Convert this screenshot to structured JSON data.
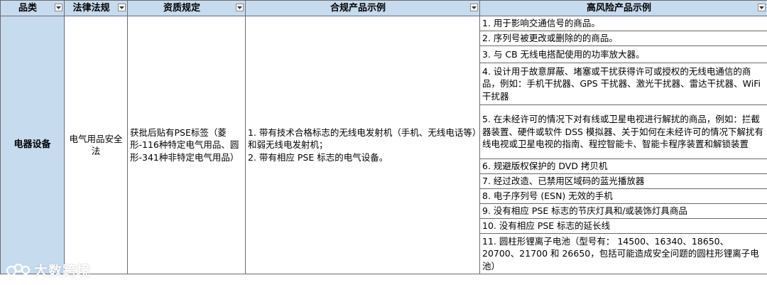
{
  "headers": {
    "category": "品类",
    "law": "法律法规",
    "qualification": "资质规定",
    "compliant": "合规产品示例",
    "high_risk": "高风险产品示例"
  },
  "row": {
    "category": "电器设备",
    "law": "电气用品安全法",
    "qualification": "获批后贴有PSE标签（菱形-116种特定电气用品、圆形-341种非特定电气用品）",
    "compliant": [
      "1. 带有技术合格标志的无线电发射机（手机、无线电话等）和弱无线电发射机；",
      "2. 带有相应 PSE 标志的电气设备。"
    ],
    "high_risk": [
      "1. 用于影响交通信号的商品。",
      "2. 序列号被更改或删除的的商品。",
      "3. 与 CB 无线电搭配使用的功率放大器。",
      "4. 设计用于故意屏蔽、堵塞或干扰获得许可或授权的无线电通信的商品，例如：手机干扰器、GPS 干扰器、激光干扰器、雷达干扰器、WiFi 干扰器",
      "5. 在未经许可的情况下对有线或卫星电视进行解扰的商品，例如：拦截器装置、硬件或软件 DSS 模拟器、关于如何在未经许可的情况下解扰有线电视或卫星电视的指南、程控智能卡、智能卡程序装置和解锁装置",
      "6. 规避版权保护的 DVD 拷贝机",
      "7. 经过改造、已禁用区域码的蓝光播放器",
      "8. 电子序列号 (ESN) 无效的手机",
      "9. 没有相应 PSE 标志的节庆灯具和/或装饰灯具商品",
      "10. 没有相应 PSE 标志的延长线",
      "11. 圆柱形锂离子电池（型号有： 14500、16340、18650、20700、21700 和 26650，包括可能造成安全问题的圆柱形锂离子电池）"
    ]
  },
  "watermark": {
    "text": "大数跨境",
    "icon": "brand-logo-icon"
  },
  "icons": {
    "filter": "dropdown-arrow-icon"
  },
  "colors": {
    "header_bg": "#c7dbef",
    "border": "#6b6b6b"
  }
}
